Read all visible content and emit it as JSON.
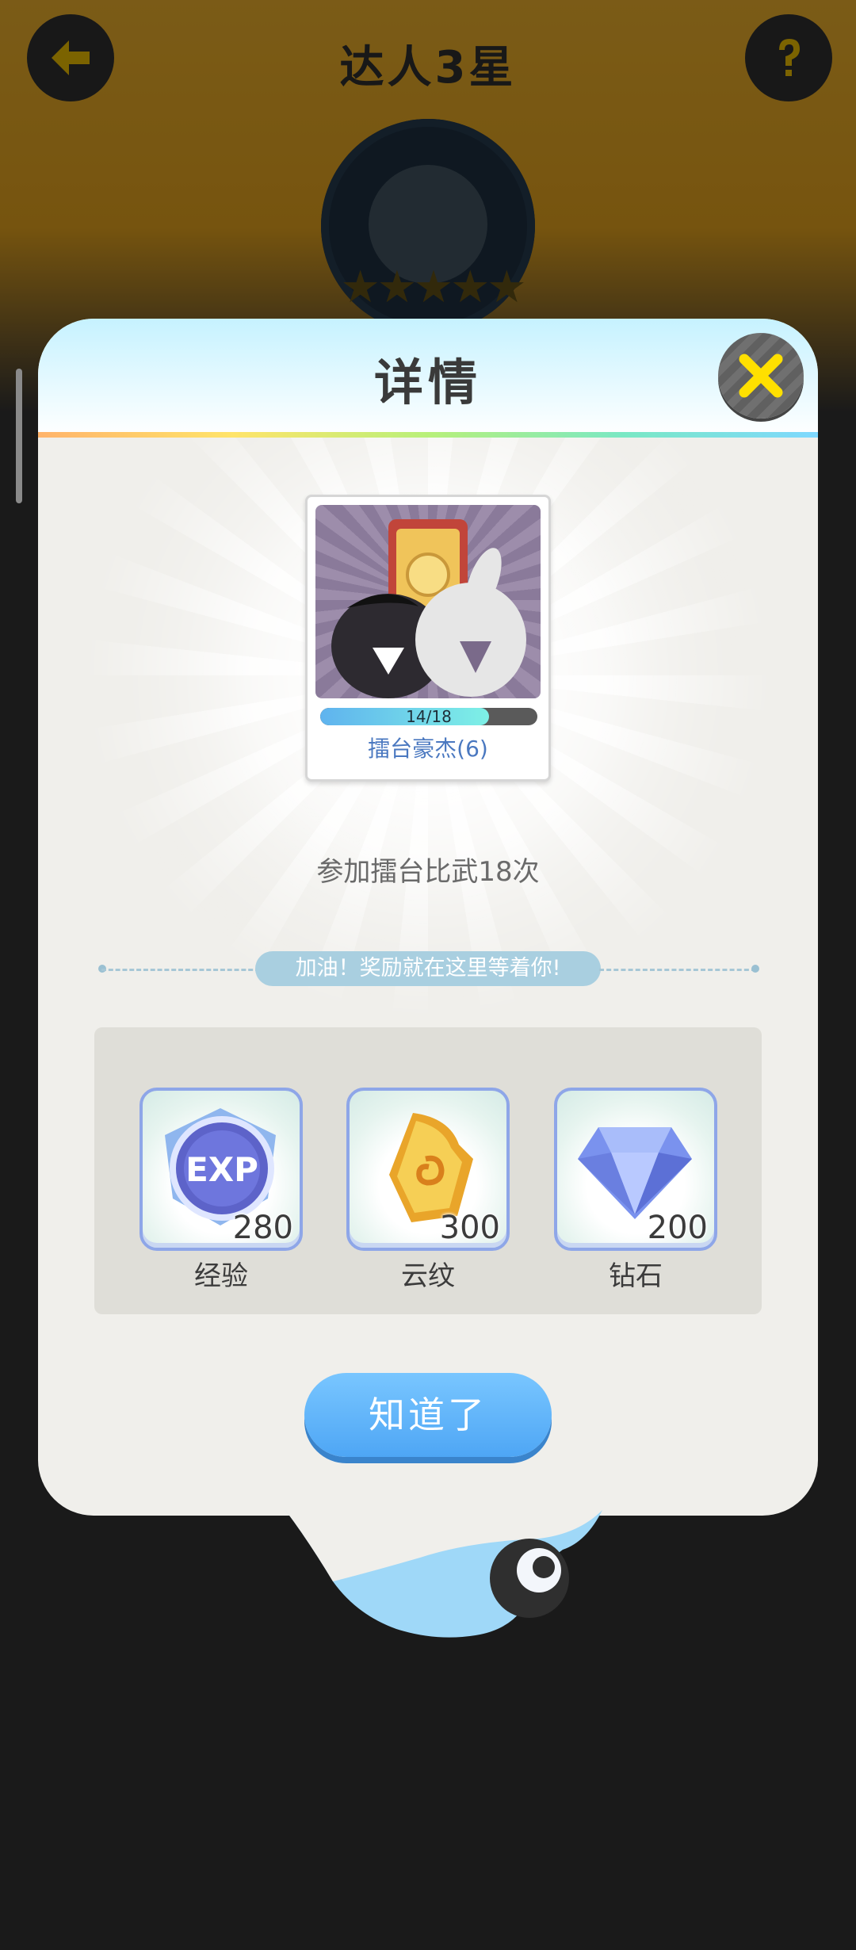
{
  "background": {
    "title": "达人3星",
    "stars": "★★★★★",
    "back_icon": "back-arrow-icon",
    "help_icon": "question-mark-icon"
  },
  "modal": {
    "title": "详情",
    "close_icon": "close-x-icon",
    "card": {
      "progress_text": "14/18",
      "progress_current": 14,
      "progress_total": 18,
      "name": "擂台豪杰(6)"
    },
    "description": "参加擂台比武18次",
    "cheer_text": "加油！奖励就在这里等着你!",
    "rewards": [
      {
        "icon": "exp-orb-icon",
        "quantity": "280",
        "label": "经验"
      },
      {
        "icon": "cloud-pattern-crystal-icon",
        "quantity": "300",
        "label": "云纹"
      },
      {
        "icon": "diamond-icon",
        "quantity": "200",
        "label": "钻石"
      }
    ],
    "ok_button": "知道了"
  },
  "colors": {
    "accent_blue": "#4ea6f5",
    "close_yellow": "#ffe000",
    "card_name": "#4a78c0"
  }
}
